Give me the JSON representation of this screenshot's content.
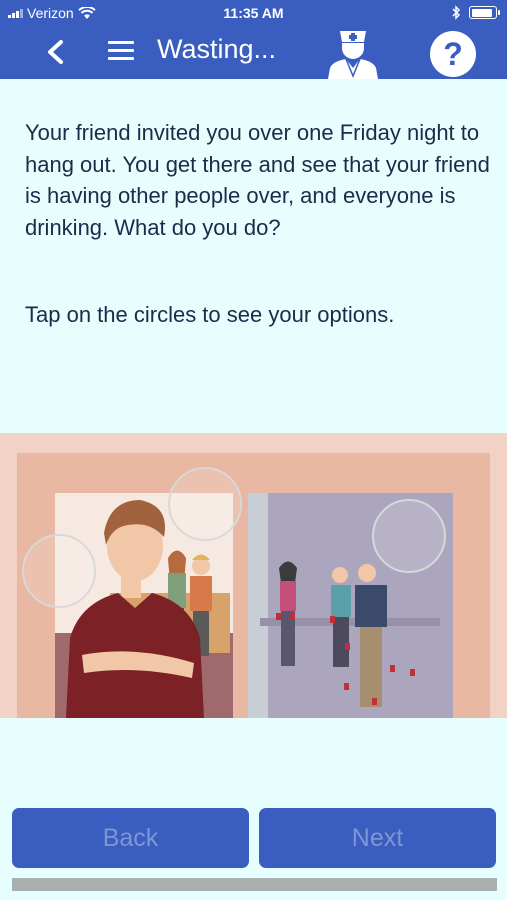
{
  "status_bar": {
    "carrier": "Verizon",
    "time": "11:35 AM",
    "icons": [
      "signal-icon",
      "wifi-icon",
      "bluetooth-icon",
      "battery-icon"
    ],
    "battery_level": 0.9
  },
  "nav": {
    "title": "Wasting...",
    "help_label": "?",
    "icons": [
      "back-icon",
      "menu-icon",
      "doctor-icon",
      "help-icon"
    ]
  },
  "content": {
    "prompt": "Your friend invited you over one Friday night to hang out. You get there and see that your friend is having other people over, and everyone is drinking. What do you do?",
    "instruction": "Tap on the circles to see your options."
  },
  "illustration": {
    "option_circles": 3
  },
  "buttons": {
    "back_label": "Back",
    "next_label": "Next"
  },
  "progress": 0,
  "colors": {
    "header": "#3a5ec0",
    "background": "#e6fefd",
    "text": "#1e2a4a",
    "button": "#3a5ec0",
    "button_text_disabled": "#7e95d4",
    "progress_track": "#a9aeae"
  }
}
